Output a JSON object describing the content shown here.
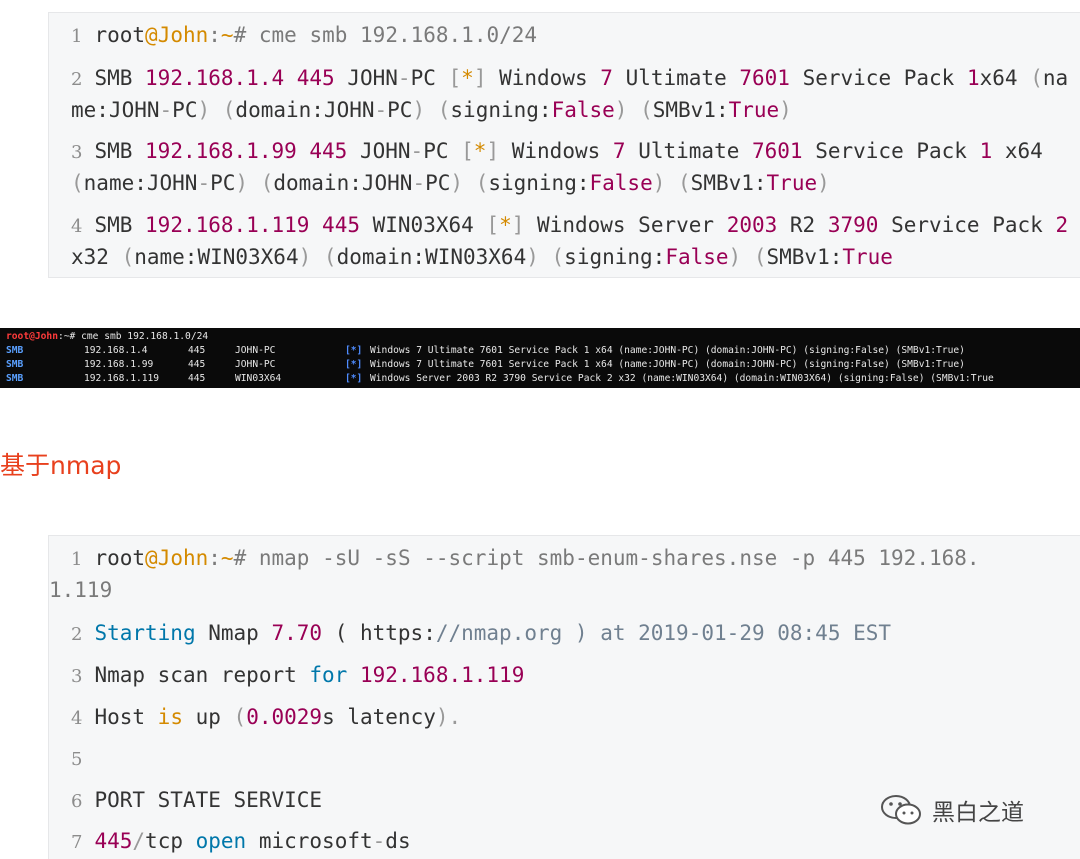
{
  "block1": {
    "line1": {
      "num": "1",
      "user": "root",
      "at": "@",
      "host": "John",
      "colon": ":",
      "tilde": "~",
      "prompt": "#",
      "cmd": " cme smb ",
      "ip": "192.168.1.0/24"
    },
    "line2": {
      "num": "2",
      "a": "SMB ",
      "ip": "192.168.1.4",
      "port": " 445",
      "b": " JOHN",
      "dash": "-",
      "c": "PC ",
      "br1": "[",
      "star": "*",
      "br2": "]",
      "d": " Windows ",
      "seven": "7",
      "e": " Ultimate ",
      "build": "7601",
      "f": " Service Pack ",
      "one": "1",
      "g": "x64 ",
      "p1": "(",
      "h": "name:JOHN",
      "dash2": "-",
      "i": "PC",
      "p2": ")",
      "p3": " (",
      "j": "domain:JOHN",
      "dash3": "-",
      "k": "PC",
      "p4": ")",
      "p5": " (",
      "l": "signing:",
      "false": "False",
      "p6": ")",
      "p7": " (",
      "m": "SMBv1:",
      "true": "True",
      "p8": ")"
    },
    "line3": {
      "num": "3",
      "a": "SMB ",
      "ip": "192.168.1.99",
      "port": " 445",
      "b": " JOHN",
      "dash": "-",
      "c": "PC ",
      "br1": "[",
      "star": "*",
      "br2": "]",
      "d": " Windows ",
      "seven": "7",
      "e": " Ultimate ",
      "build": "7601",
      "f": " Service Pack ",
      "one": "1",
      "g": " x64 ",
      "p1": "(",
      "h": "name:JOHN",
      "dash2": "-",
      "i": "PC",
      "p2": ")",
      "p3": " (",
      "j": "domain:JOHN",
      "dash3": "-",
      "k": "PC",
      "p4": ")",
      "p5": " (",
      "l": "signing:",
      "false": "False",
      "p6": ")",
      "p7": " (",
      "m": "SMBv1:",
      "true": "True",
      "p8": ")"
    },
    "line4": {
      "num": "4",
      "a": "SMB ",
      "ip": "192.168.1.119",
      "port": " 445",
      "b": " WIN03X64 ",
      "br1": "[",
      "star": "*",
      "br2": "]",
      "d": " Windows Server ",
      "year": "2003",
      "e": " R2 ",
      "build": "3790",
      "f": " Service Pack ",
      "two": "2",
      "g": " x32 ",
      "p1": "(",
      "h": "name:WIN03X64",
      "p2": ")",
      "p3": " (",
      "j": "domain:WIN03X64",
      "p4": ")",
      "p5": " (",
      "l": "signing:",
      "false": "False",
      "p6": ")",
      "p7": " (",
      "m": "SMBv1:",
      "true": "True"
    }
  },
  "terminal": {
    "prompt_user": "root@John",
    "prompt_rest": ":~# cme smb 192.168.1.0/24",
    "rows": [
      {
        "proto": "SMB",
        "ip": "192.168.1.4",
        "port": "445",
        "host": "JOHN-PC",
        "star": "[*]",
        "info": "Windows 7 Ultimate 7601 Service Pack 1 x64 (name:JOHN-PC) (domain:JOHN-PC) (signing:False) (SMBv1:True)"
      },
      {
        "proto": "SMB",
        "ip": "192.168.1.99",
        "port": "445",
        "host": "JOHN-PC",
        "star": "[*]",
        "info": "Windows 7 Ultimate 7601 Service Pack 1 x64 (name:JOHN-PC) (domain:JOHN-PC) (signing:False) (SMBv1:True)"
      },
      {
        "proto": "SMB",
        "ip": "192.168.1.119",
        "port": "445",
        "host": "WIN03X64",
        "star": "[*]",
        "info": "Windows Server 2003 R2 3790 Service Pack 2 x32 (name:WIN03X64) (domain:WIN03X64) (signing:False) (SMBv1:True"
      }
    ]
  },
  "heading": "基于nmap",
  "block2": {
    "line1": {
      "num": "1",
      "user": "root",
      "at": "@",
      "host": "John",
      "colon": ":",
      "tilde": "~",
      "prompt": "#",
      "cmd": " nmap -sU -sS --script smb-enum-shares.nse -p 445 192.168.",
      "cont": "1.119"
    },
    "line2": {
      "num": "2",
      "starting": "Starting",
      "a": " Nmap ",
      "ver": "7.70",
      "b": " ( https:",
      "slash": "//nmap.org ) at 2019",
      "dash1": "-",
      "c": "01",
      "dash2": "-",
      "d": "29 08:45 EST"
    },
    "line3": {
      "num": "3",
      "a": "Nmap scan report ",
      "for": "for",
      "ip": " 192.168.1.119"
    },
    "line4": {
      "num": "4",
      "a": "Host ",
      "is": "is",
      "b": " up ",
      "p1": "(",
      "lat": "0.0029",
      "c": "s latency",
      ")": ")",
      "dot": "."
    },
    "line5": {
      "num": "5"
    },
    "line6": {
      "num": "6",
      "a": "PORT STATE SERVICE"
    },
    "line7": {
      "num": "7",
      "port": "445",
      "slash": "/",
      "tcp": "tcp ",
      "open": "open",
      "b": " microsoft",
      "dash": "-",
      "c": "ds"
    }
  },
  "watermark": {
    "text": "黑白之道",
    "icon": "wechat-icon"
  }
}
